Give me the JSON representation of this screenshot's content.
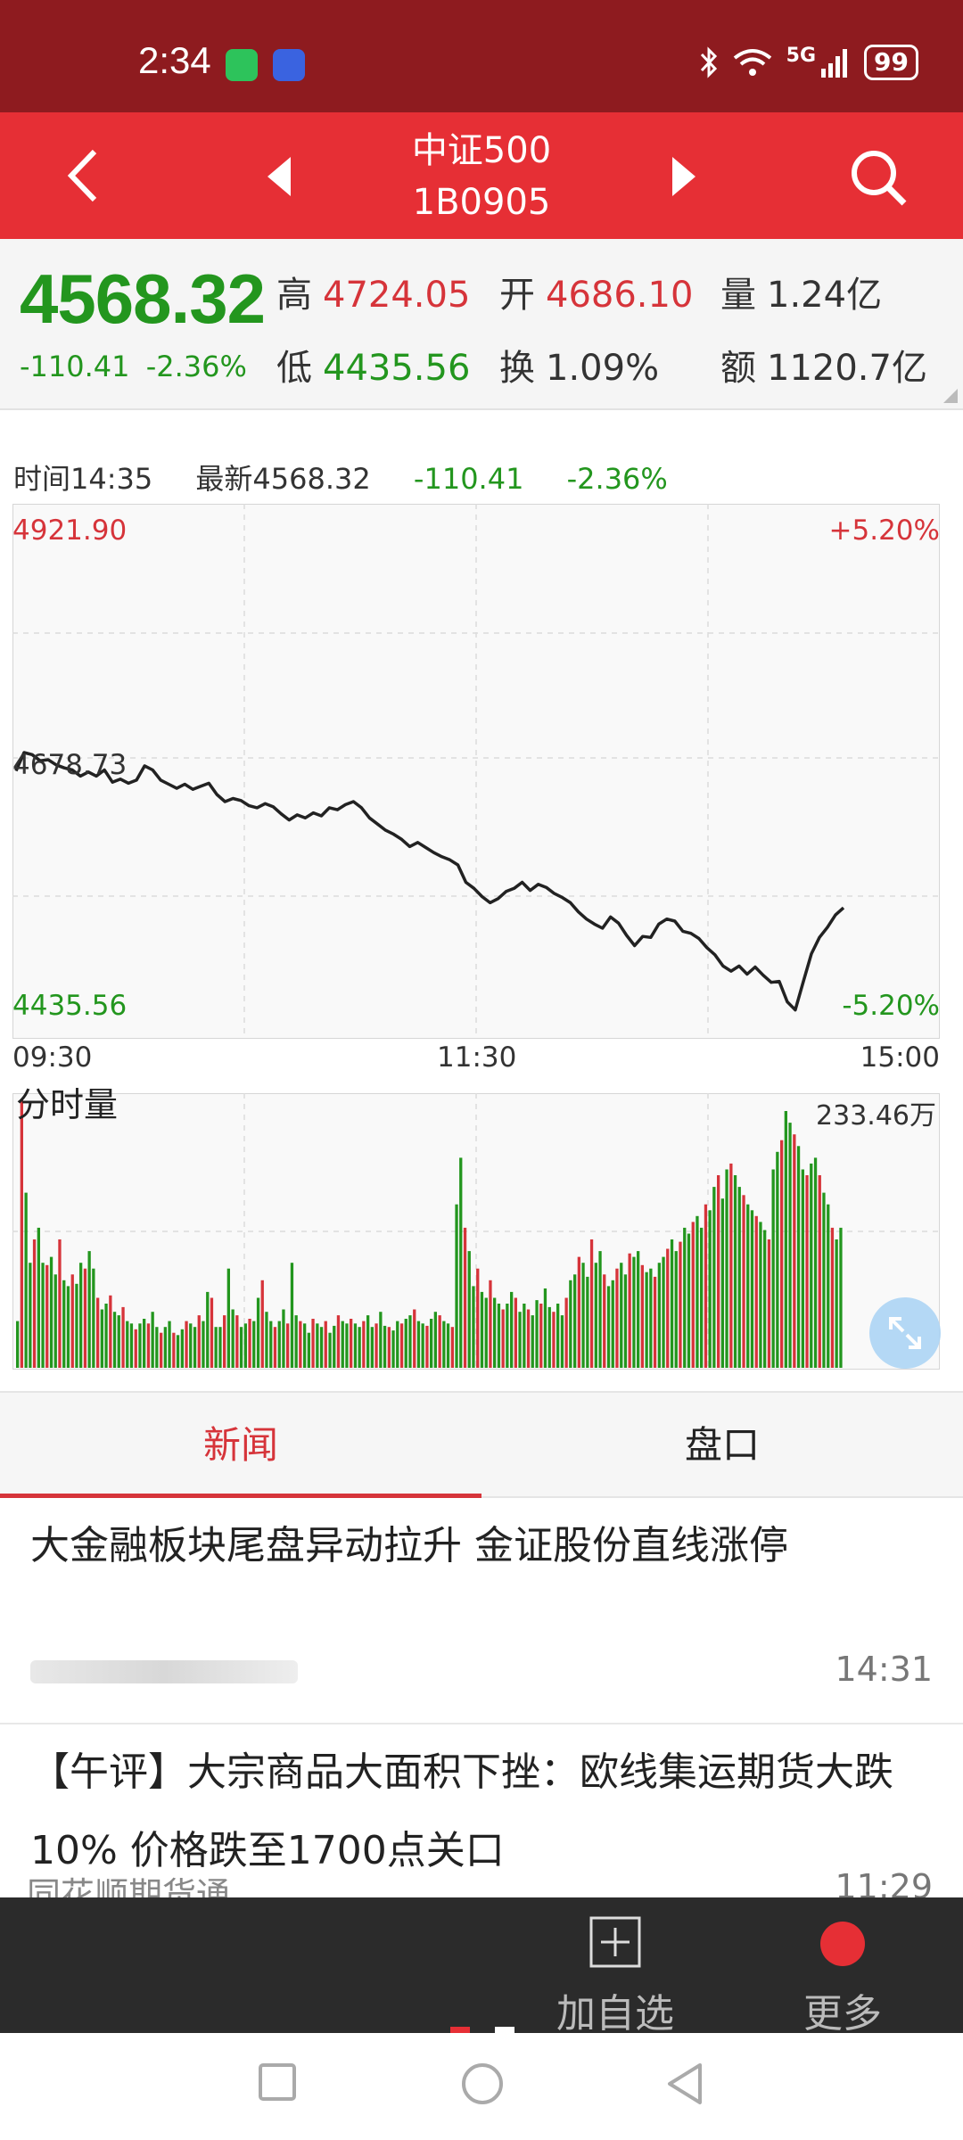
{
  "status_bar": {
    "time": "2:34",
    "signal_label": "5G",
    "battery": "99",
    "icons": [
      "wechat-icon",
      "app-notification-icon",
      "bluetooth-icon",
      "wifi-icon",
      "signal-icon",
      "battery-icon"
    ]
  },
  "header": {
    "title": "中证500",
    "code": "1B0905",
    "colors": {
      "bg": "#e62f35"
    }
  },
  "quote": {
    "price": "4568.32",
    "change": "-110.41",
    "change_pct": "-2.36%",
    "high_label": "高",
    "high": "4724.05",
    "open_label": "开",
    "open": "4686.10",
    "volume_label": "量",
    "volume": "1.24亿",
    "low_label": "低",
    "low": "4435.56",
    "turnover_label": "换",
    "turnover": "1.09%",
    "amount_label": "额",
    "amount": "1120.7亿"
  },
  "chart_info": {
    "time": "时间14:35",
    "latest": "最新4568.32",
    "change": "-110.41",
    "change_pct": "-2.36%"
  },
  "chart_data": {
    "type": "line",
    "y_top": "4921.90",
    "y_mid": "4678.73",
    "y_bottom": "4435.56",
    "pct_top": "+5.20%",
    "pct_bottom": "-5.20%",
    "x_labels": [
      "09:30",
      "11:30",
      "15:00"
    ],
    "ylim": [
      4435.56,
      4921.9
    ],
    "values": [
      4676,
      4694,
      4692,
      4686,
      4687,
      4682,
      4679,
      4677,
      4671,
      4675,
      4671,
      4677,
      4665,
      4668,
      4664,
      4667,
      4681,
      4677,
      4667,
      4663,
      4659,
      4663,
      4658,
      4661,
      4664,
      4653,
      4646,
      4649,
      4647,
      4642,
      4640,
      4644,
      4641,
      4634,
      4628,
      4633,
      4630,
      4635,
      4632,
      4640,
      4638,
      4643,
      4646,
      4640,
      4630,
      4624,
      4618,
      4614,
      4609,
      4602,
      4606,
      4601,
      4596,
      4592,
      4589,
      4584,
      4567,
      4561,
      4553,
      4547,
      4551,
      4558,
      4561,
      4567,
      4559,
      4565,
      4562,
      4556,
      4552,
      4547,
      4538,
      4531,
      4526,
      4522,
      4533,
      4527,
      4515,
      4505,
      4514,
      4513,
      4526,
      4531,
      4529,
      4519,
      4517,
      4512,
      4503,
      4496,
      4485,
      4480,
      4485,
      4477,
      4484,
      4476,
      4469,
      4470,
      4450,
      4442,
      4470,
      4497,
      4513,
      4523,
      4535,
      4542
    ],
    "volume": {
      "title": "分时量",
      "max_label": "233.46万",
      "values": [
        40,
        230,
        150,
        90,
        110,
        120,
        90,
        88,
        95,
        80,
        110,
        75,
        70,
        80,
        72,
        90,
        85,
        100,
        85,
        60,
        50,
        55,
        62,
        48,
        45,
        52,
        40,
        38,
        33,
        38,
        42,
        38,
        48,
        35,
        30,
        35,
        40,
        30,
        28,
        33,
        40,
        38,
        35,
        45,
        40,
        65,
        60,
        35,
        35,
        45,
        85,
        50,
        45,
        35,
        38,
        42,
        40,
        60,
        75,
        48,
        40,
        35,
        40,
        50,
        38,
        90,
        45,
        40,
        38,
        30,
        42,
        38,
        35,
        40,
        30,
        36,
        45,
        40,
        38,
        42,
        38,
        35,
        40,
        45,
        35,
        38,
        48,
        36,
        35,
        32,
        40,
        38,
        42,
        45,
        50,
        40,
        38,
        36,
        42,
        48,
        45,
        40,
        38,
        35,
        140,
        180,
        120,
        100,
        70,
        85,
        65,
        60,
        75,
        60,
        55,
        50,
        55,
        65,
        60,
        48,
        55,
        50,
        45,
        58,
        55,
        68,
        52,
        48,
        55,
        45,
        60,
        75,
        80,
        95,
        90,
        78,
        110,
        90,
        100,
        80,
        70,
        75,
        85,
        90,
        80,
        98,
        95,
        100,
        88,
        82,
        85,
        78,
        90,
        95,
        102,
        110,
        100,
        108,
        120,
        115,
        125,
        130,
        120,
        140,
        135,
        155,
        165,
        145,
        170,
        175,
        165,
        155,
        148,
        140,
        135,
        130,
        125,
        118,
        110,
        170,
        185,
        195,
        220,
        210,
        200,
        190,
        170,
        165,
        175,
        180,
        165,
        150,
        140,
        120,
        110,
        120
      ]
    }
  },
  "tabs": [
    {
      "label": "新闻"
    },
    {
      "label": "盘口"
    }
  ],
  "news": [
    {
      "title": "大金融板块尾盘异动拉升 金证股份直线涨停",
      "time": "14:31"
    },
    {
      "title": "【午评】大宗商品大面积下挫：欧线集运期货大跌10% 价格跌至1700点关口",
      "source": "同花顺期货通",
      "time": "11:29"
    }
  ],
  "toolbar": {
    "add_label": "加自选",
    "more_label": "更多"
  }
}
